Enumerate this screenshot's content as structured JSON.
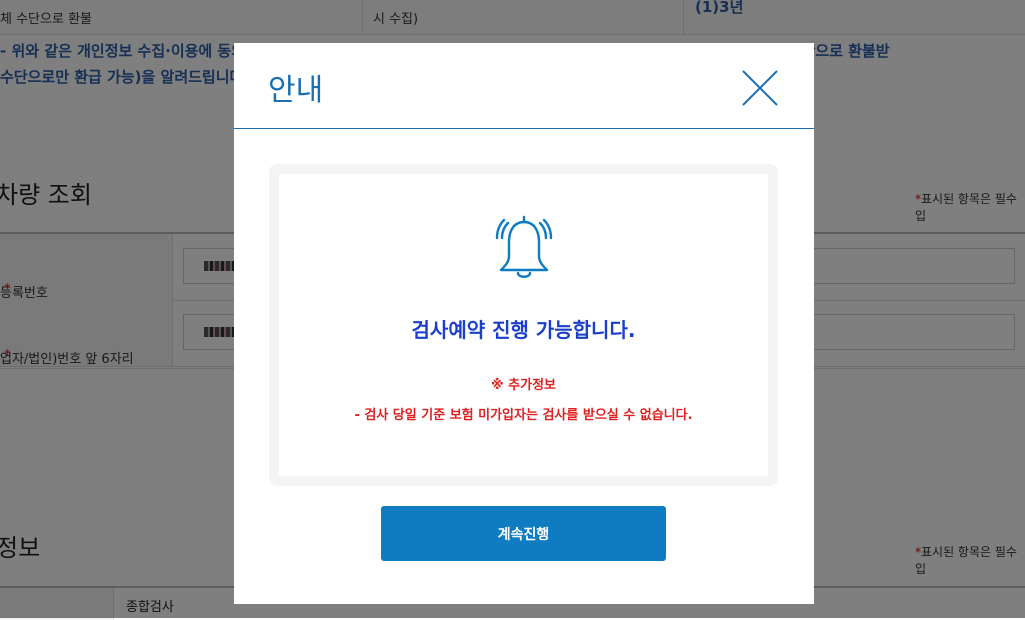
{
  "background": {
    "top_row": {
      "cell_a": "체 수단으로 환불",
      "cell_b": "시 수집)",
      "cell_c": "(1)3년"
    },
    "notice_lines": [
      "- 위와 같은 개인정보 수집·이용에 동의하지 않으실 수 있습니다. 동의 거부 시 검사예약 서비스 환불(취소) 이용 시 계좌이체 수단으로 환불받",
      "수단으로만 환급 가능)을 알려드립니다."
    ],
    "section1_title": "차량 조회",
    "required_note": "표시된 항목은 필수입",
    "required_star": "*",
    "form_rows": [
      {
        "label": "등록번호",
        "star": "*"
      },
      {
        "label": "업자/법인)번호 앞 6자리",
        "star": "*"
      }
    ],
    "section2_title": "정보",
    "bottom_row_value": "종합검사"
  },
  "modal": {
    "title": "안내",
    "main_message": "검사예약 진행 가능합니다.",
    "extra_title": "※ 추가정보",
    "extra_desc": "- 검사 당일 기준 보험 미가입자는 검사를 받으실 수 없습니다.",
    "continue_label": "계속진행",
    "icons": {
      "close": "close-icon",
      "bell": "bell-icon"
    },
    "colors": {
      "accent": "#0f7cc1",
      "title": "#1a6fb0",
      "message": "#1a3fcc",
      "warning": "#e02020"
    }
  }
}
